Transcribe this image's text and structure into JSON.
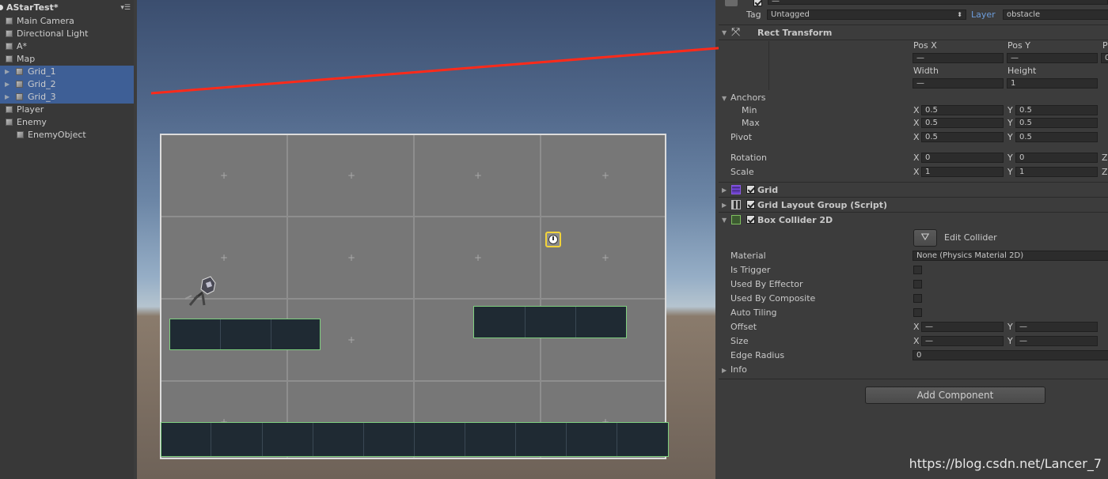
{
  "hierarchy": {
    "scene_name": "AStarTest*",
    "menu_icon": "list-menu-icon",
    "items": [
      {
        "label": "Main Camera"
      },
      {
        "label": "Directional Light"
      },
      {
        "label": "A*"
      },
      {
        "label": "Map"
      },
      {
        "label": "Grid_1"
      },
      {
        "label": "Grid_2"
      },
      {
        "label": "Grid_3"
      },
      {
        "label": "Player"
      },
      {
        "label": "Enemy"
      },
      {
        "label": "EnemyObject"
      }
    ]
  },
  "inspector": {
    "tag_label": "Tag",
    "tag_value": "Untagged",
    "layer_label": "Layer",
    "layer_value": "obstacle",
    "rect_transform": {
      "title": "Rect Transform",
      "pos_x_label": "Pos X",
      "pos_y_label": "Pos Y",
      "pos_z_label": "P",
      "pos_x": "—",
      "pos_y": "—",
      "pos_z": "0",
      "width_label": "Width",
      "height_label": "Height",
      "width": "—",
      "height": "1",
      "anchors_label": "Anchors",
      "min_label": "Min",
      "max_label": "Max",
      "pivot_label": "Pivot",
      "x_letter": "X",
      "y_letter": "Y",
      "z_letter": "Z",
      "min_x": "0.5",
      "min_y": "0.5",
      "max_x": "0.5",
      "max_y": "0.5",
      "pivot_x": "0.5",
      "pivot_y": "0.5",
      "rotation_label": "Rotation",
      "rotation_x": "0",
      "rotation_y": "0",
      "scale_label": "Scale",
      "scale_x": "1",
      "scale_y": "1"
    },
    "grid_title": "Grid",
    "grid_layout_title": "Grid Layout Group (Script)",
    "box_collider": {
      "title": "Box Collider 2D",
      "edit_collider": "Edit Collider",
      "material_label": "Material",
      "material_value": "None (Physics Material 2D)",
      "is_trigger": "Is Trigger",
      "used_by_effector": "Used By Effector",
      "used_by_composite": "Used By Composite",
      "auto_tiling": "Auto Tiling",
      "offset_label": "Offset",
      "offset_x": "—",
      "offset_y": "—",
      "size_label": "Size",
      "size_x": "—",
      "size_y": "—",
      "edge_radius_label": "Edge Radius",
      "edge_radius": "0",
      "info_label": "Info"
    },
    "add_component": "Add Component"
  },
  "watermark": "https://blog.csdn.net/Lancer_7",
  "colors": {
    "selection": "#3e5f96",
    "annotation_arrow": "#ff2a1a",
    "layer_label": "#6d9ddb"
  }
}
